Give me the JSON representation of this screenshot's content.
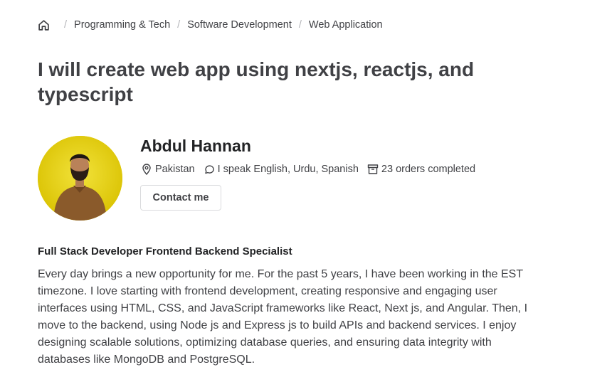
{
  "breadcrumb": {
    "home_icon": "home-icon",
    "items": [
      "Programming & Tech",
      "Software Development",
      "Web Application"
    ]
  },
  "gig": {
    "title": "I will create web app using nextjs, reactjs, and typescript"
  },
  "seller": {
    "name": "Abdul Hannan",
    "location": "Pakistan",
    "languages": "I speak English, Urdu, Spanish",
    "orders": "23 orders completed",
    "contact_label": "Contact me",
    "avatar_background": "#e9d30a",
    "icons": {
      "location": "location-pin-icon",
      "languages": "speech-bubble-icon",
      "orders": "orders-box-icon"
    }
  },
  "about": {
    "headline": "Full Stack Developer Frontend Backend Specialist",
    "description": "Every day brings a new opportunity for me. For the past 5 years, I have been working in the EST timezone. I love starting with frontend development, creating responsive and engaging user interfaces using HTML, CSS, and JavaScript frameworks like React, Next js, and Angular. Then, I move to the backend, using Node js and Express js to build APIs and backend services. I enjoy designing scalable solutions, optimizing database queries, and ensuring data integrity with databases like MongoDB and PostgreSQL."
  }
}
